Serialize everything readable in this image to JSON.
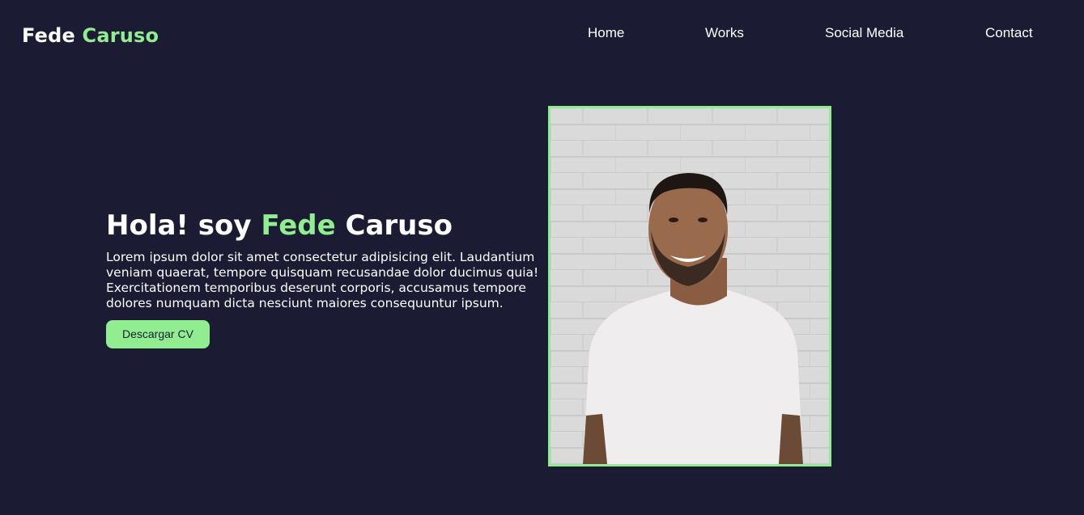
{
  "header": {
    "logo_first": "Fede",
    "logo_last": "Caruso"
  },
  "nav": {
    "items": [
      "Home",
      "Works",
      "Social Media",
      "Contact"
    ]
  },
  "hero": {
    "greeting": "Hola! soy",
    "name_first": "Fede",
    "name_last": "Caruso",
    "description": "Lorem ipsum dolor sit amet consectetur adipisicing elit. Laudantium veniam quaerat, tempore quisquam recusandae dolor ducimus quia! Exercitationem temporibus deserunt corporis, accusamus tempore dolores numquam dicta nesciunt maiores consequuntur ipsum.",
    "button_label": "Descargar CV"
  },
  "colors": {
    "background": "#1b1c34",
    "accent": "#90ee90",
    "text": "#ffffff"
  }
}
